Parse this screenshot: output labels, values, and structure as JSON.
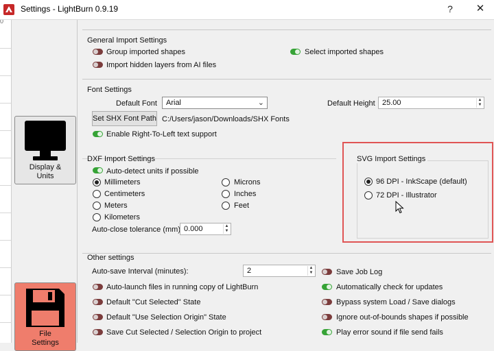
{
  "window": {
    "title": "Settings - LightBurn 0.9.19",
    "help_glyph": "?",
    "close_glyph": "✕"
  },
  "background": {
    "ruler_text": "0"
  },
  "categories": {
    "display_label": "Display &\nUnits",
    "file_label": "File\nSettings"
  },
  "general_import": {
    "title": "General Import Settings",
    "group_imported": {
      "label": "Group imported shapes",
      "on": false
    },
    "select_imported": {
      "label": "Select imported shapes",
      "on": true
    },
    "import_hidden": {
      "label": "Import hidden layers from AI files",
      "on": false
    }
  },
  "font": {
    "title": "Font Settings",
    "default_font_label": "Default Font",
    "default_font_value": "Arial",
    "default_height_label": "Default Height",
    "default_height_value": "25.00",
    "shx_button": "Set SHX Font Path",
    "shx_path": "C:/Users/jason/Downloads/SHX Fonts",
    "rtl": {
      "label": "Enable Right-To-Left text support",
      "on": true
    }
  },
  "dxf": {
    "title": "DXF Import Settings",
    "auto_detect": {
      "label": "Auto-detect units if possible",
      "on": true
    },
    "units": [
      {
        "label": "Millimeters",
        "checked": true
      },
      {
        "label": "Centimeters",
        "checked": false
      },
      {
        "label": "Meters",
        "checked": false
      },
      {
        "label": "Kilometers",
        "checked": false
      },
      {
        "label": "Microns",
        "checked": false
      },
      {
        "label": "Inches",
        "checked": false
      },
      {
        "label": "Feet",
        "checked": false
      }
    ],
    "tolerance_label": "Auto-close tolerance (mm)",
    "tolerance_value": "0.000"
  },
  "svg": {
    "title": "SVG Import Settings",
    "options": [
      {
        "label": "96 DPI - InkScape (default)",
        "checked": true
      },
      {
        "label": "72 DPI - Illustrator",
        "checked": false
      }
    ],
    "highlight_color": "#e05454"
  },
  "other": {
    "title": "Other settings",
    "autosave_label": "Auto-save Interval (minutes):",
    "autosave_value": "2",
    "left": [
      {
        "label": "Auto-launch files in running copy of LightBurn",
        "on": false
      },
      {
        "label": "Default \"Cut Selected\" State",
        "on": false
      },
      {
        "label": "Default \"Use Selection Origin\" State",
        "on": false
      },
      {
        "label": "Save Cut Selected / Selection Origin to project",
        "on": false
      }
    ],
    "right": [
      {
        "label": "Save Job Log",
        "on": false
      },
      {
        "label": "Automatically check for updates",
        "on": true
      },
      {
        "label": "Bypass system Load / Save dialogs",
        "on": false
      },
      {
        "label": "Ignore out-of-bounds shapes if possible",
        "on": false
      },
      {
        "label": "Play error sound if file send fails",
        "on": true
      }
    ]
  },
  "colors": {
    "toggle_on": "#36a336",
    "toggle_off": "#7b3c3c",
    "file_category_bg": "#ef7d6c"
  }
}
